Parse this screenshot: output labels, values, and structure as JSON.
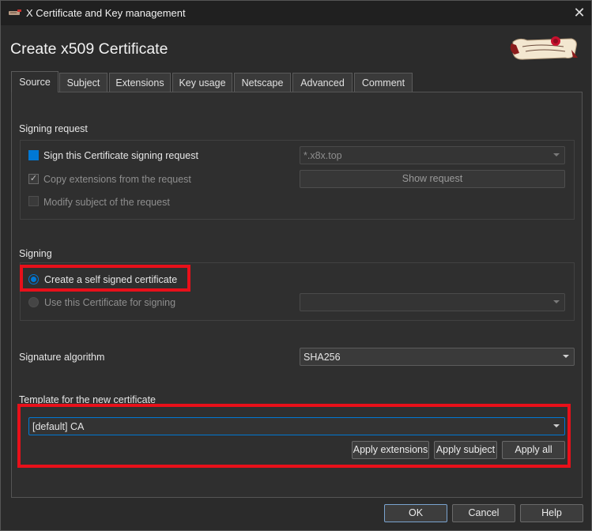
{
  "window": {
    "title": "X Certificate and Key management",
    "close_glyph": "✕"
  },
  "heading": "Create x509 Certificate",
  "tabs": [
    {
      "label": "Source",
      "active": true
    },
    {
      "label": "Subject"
    },
    {
      "label": "Extensions"
    },
    {
      "label": "Key usage"
    },
    {
      "label": "Netscape"
    },
    {
      "label": "Advanced"
    },
    {
      "label": "Comment"
    }
  ],
  "signing_request": {
    "section_label": "Signing request",
    "sign_csr_label": "Sign this Certificate signing request",
    "sign_csr_checked": false,
    "csr_select_value": "*.x8x.top",
    "copy_ext_label": "Copy extensions from the request",
    "copy_ext_checked": true,
    "check_glyph": "✓",
    "show_request_label": "Show request",
    "modify_subject_label": "Modify subject of the request",
    "modify_subject_checked": false
  },
  "signing": {
    "section_label": "Signing",
    "self_signed_label": "Create a self signed certificate",
    "self_signed_selected": true,
    "use_cert_label": "Use this Certificate for signing",
    "use_cert_select_value": ""
  },
  "signature_algorithm": {
    "label": "Signature algorithm",
    "value": "SHA256"
  },
  "template": {
    "section_label": "Template for the new certificate",
    "value": "[default] CA",
    "apply_extensions_label": "Apply extensions",
    "apply_subject_label": "Apply subject",
    "apply_all_label": "Apply all"
  },
  "footer": {
    "ok_label": "OK",
    "cancel_label": "Cancel",
    "help_label": "Help"
  },
  "colors": {
    "accent": "#0078d4",
    "highlight_box": "#e8101a",
    "window_bg": "#2b2b2b",
    "titlebar_bg": "#202020"
  },
  "icons": {
    "app": "certificate-key-app-icon",
    "logo": "scroll-seal-logo",
    "close": "close-icon",
    "dropdown": "chevron-down-icon"
  }
}
